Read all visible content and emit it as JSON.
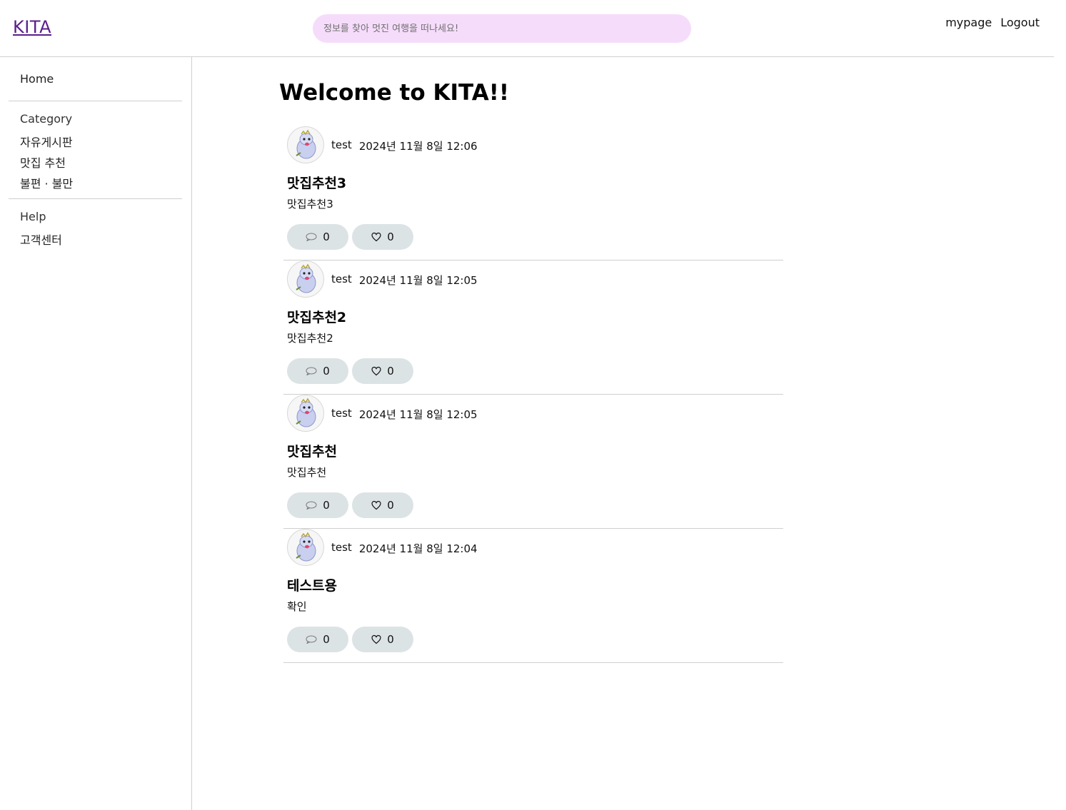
{
  "header": {
    "logo": "KITA",
    "search_placeholder": "정보를 찾아 멋진 여행을 떠나세요!",
    "links": [
      "mypage",
      "Logout"
    ]
  },
  "sidebar": {
    "home": "Home",
    "category_heading": "Category",
    "categories": [
      "자유게시판",
      "맛집 추천",
      "불편 · 불만"
    ],
    "help_heading": "Help",
    "help_items": [
      "고객센터"
    ]
  },
  "main": {
    "title": "Welcome to KITA!!",
    "posts": [
      {
        "author": "test",
        "date": "2024년 11월 8일 12:06",
        "title": "맛집추천3",
        "body": "맛집추천3",
        "comments": "0",
        "likes": "0"
      },
      {
        "author": "test",
        "date": "2024년 11월 8일 12:05",
        "title": "맛집추천2",
        "body": "맛집추천2",
        "comments": "0",
        "likes": "0"
      },
      {
        "author": "test",
        "date": "2024년 11월 8일 12:05",
        "title": "맛집추천",
        "body": "맛집추천",
        "comments": "0",
        "likes": "0"
      },
      {
        "author": "test",
        "date": "2024년 11월 8일 12:04",
        "title": "테스트용",
        "body": "확인",
        "comments": "0",
        "likes": "0"
      }
    ]
  },
  "colors": {
    "logo": "#5b1e8a",
    "search_bg": "#f6dcfb",
    "pill_bg": "#dce3e5",
    "divider": "#cfcfcf"
  },
  "icons": {
    "comment": "speech-bubble-icon",
    "like": "heart-outline-icon",
    "avatar": "cartoon-mascot-avatar"
  }
}
